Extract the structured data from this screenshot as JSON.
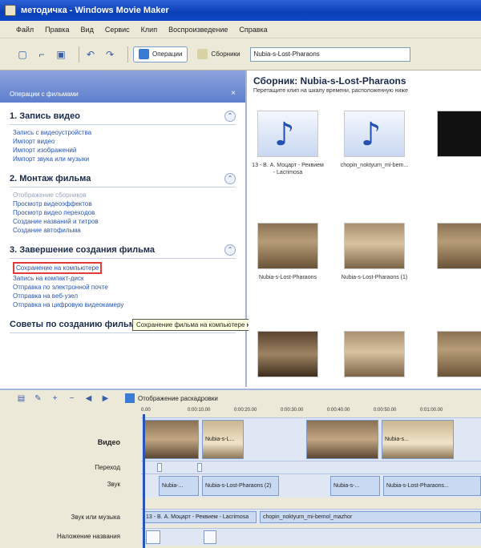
{
  "window": {
    "title": "методичка - Windows Movie Maker"
  },
  "menu": [
    "Файл",
    "Правка",
    "Вид",
    "Сервис",
    "Клип",
    "Воспроизведение",
    "Справка"
  ],
  "toolbar": {
    "operations_label": "Операции",
    "collections_label": "Сборники",
    "combo_value": "Nubia-s-Lost-Pharaons"
  },
  "tasks": {
    "header": "Операции с фильмами",
    "sections": [
      {
        "title": "1. Запись видео",
        "links": [
          "Запись с видеоустройства",
          "Импорт видео",
          "Импорт изображений",
          "Импорт звука или музыки"
        ]
      },
      {
        "title": "2. Монтаж фильма",
        "links": [
          "Отображение сборников",
          "Просмотр видеоэффектов",
          "Просмотр видео переходов",
          "Создание названий и титров",
          "Создание автофильма"
        ]
      },
      {
        "title": "3. Завершение создания фильма",
        "links": [
          "Сохранение на компьютере",
          "Запись на компакт-диск",
          "Отправка по электронной почте",
          "Отправка на веб-узел",
          "Отправка на цифровую видеокамеру"
        ]
      },
      {
        "title": "Советы по созданию фильмов"
      }
    ],
    "tooltip": "Сохранение фильма на компьютере как файла видео."
  },
  "collection": {
    "title": "Сборник: Nubia-s-Lost-Pharaons",
    "subtitle": "Перетащите клип на шкалу времени, расположенную ниже",
    "clips": [
      {
        "caption": "13 - В. А. Моцарт - Реквием - Lacrimosa"
      },
      {
        "caption": "chopin_noktyurn_mi-bem..."
      },
      {
        "caption": "Nubia-s-Lost-Pharaons"
      },
      {
        "caption": "Nubia-s-Lost-Pharaons (1)"
      }
    ]
  },
  "timeline": {
    "storyboard_label": "Отображение раскадровки",
    "ruler": [
      "0.00",
      "0:00:10.00",
      "0:00:20.00",
      "0:00:30.00",
      "0:00:40.00",
      "0:00:50.00",
      "0:01:00.00"
    ],
    "tracks": {
      "video": "Видео",
      "transition": "Переход",
      "audio": "Звук",
      "music": "Звук или музыка",
      "titles": "Наложение названия"
    },
    "video_clips": [
      "Nubia-s-L...",
      "Nubia-s..."
    ],
    "audio_clips": [
      "Nubia-...",
      "Nubia-s-Lost-Pharaons (2)",
      "Nubia-s-...",
      "Nubia-s-Lost-Pharaons..."
    ],
    "music_clips": [
      "13 - В. А. Моцарт - Реквием - Lacrimosa",
      "chopin_noktyurn_mi-bemol_mazhor"
    ]
  }
}
